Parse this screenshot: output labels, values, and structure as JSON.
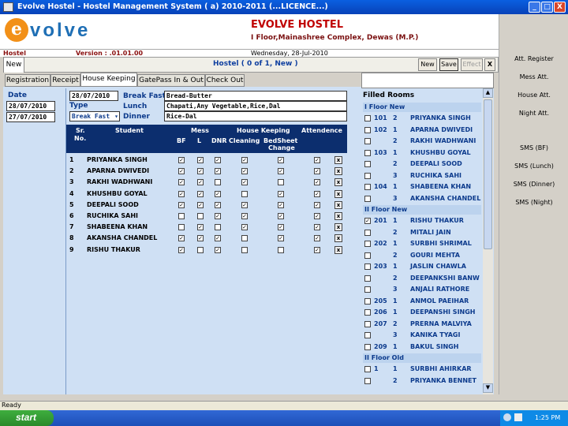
{
  "window": {
    "title": "Evolve Hostel - Hostel Management System ( a) 2010-2011 (...LICENCE...)",
    "minimize": "_",
    "maximize": "□",
    "close": "X"
  },
  "header": {
    "logo_text": "volve",
    "logo_letter": "e",
    "hostel_name": "EVOLVE HOSTEL",
    "address": "I Floor,Mainashree Complex, Dewas (M.P.)"
  },
  "infobar": {
    "module": "Hostel",
    "version": "Version : .01.01.00",
    "date": "Wednesday, 28-Jul-2010"
  },
  "ribbon": {
    "new_tab": "New",
    "form_title": "Hostel  ( 0 of 1, New )",
    "new_btn": "New",
    "save_btn": "Save",
    "effect_btn": "Effect",
    "close_btn": "X"
  },
  "tabs": [
    "Registration",
    "Receipt",
    "House Keeping",
    "GatePass In & Out",
    "Check Out"
  ],
  "datepanel": {
    "label": "Date",
    "dates": [
      "28/07/2010",
      "27/07/2010"
    ]
  },
  "menu": {
    "date": "28/07/2010",
    "type_label": "Type",
    "type_value": "Break Fast",
    "breakfast_label": "Break Fast",
    "breakfast": "Bread-Butter",
    "lunch_label": "Lunch",
    "lunch": "Chapati,Any Vegetable,Rice,Dal",
    "dinner_label": "Dinner",
    "dinner": "Rice-Dal"
  },
  "grid": {
    "headers": {
      "sr": "Sr.",
      "no": "No.",
      "student": "Student",
      "mess": "Mess",
      "bf": "BF",
      "l": "L",
      "dnr": "DNR",
      "hk": "House Keeping",
      "cleaning": "Cleaning",
      "bedsheet": "BedSheet",
      "change": "Change",
      "attendance": "Attendence"
    },
    "rows": [
      {
        "no": "1",
        "name": "PRIYANKA SINGH",
        "bf": true,
        "l": true,
        "dnr": true,
        "cleaning": true,
        "bedsheet": true,
        "att": true
      },
      {
        "no": "2",
        "name": "APARNA DWIVEDI",
        "bf": true,
        "l": true,
        "dnr": true,
        "cleaning": true,
        "bedsheet": true,
        "att": true
      },
      {
        "no": "3",
        "name": "RAKHI WADHWANI",
        "bf": true,
        "l": true,
        "dnr": false,
        "cleaning": true,
        "bedsheet": false,
        "att": true
      },
      {
        "no": "4",
        "name": "KHUSHBU GOYAL",
        "bf": true,
        "l": true,
        "dnr": true,
        "cleaning": false,
        "bedsheet": true,
        "att": true
      },
      {
        "no": "5",
        "name": "DEEPALI SOOD",
        "bf": true,
        "l": true,
        "dnr": true,
        "cleaning": true,
        "bedsheet": true,
        "att": true
      },
      {
        "no": "6",
        "name": "RUCHIKA SAHI",
        "bf": false,
        "l": false,
        "dnr": true,
        "cleaning": true,
        "bedsheet": true,
        "att": true
      },
      {
        "no": "7",
        "name": "SHABEENA KHAN",
        "bf": false,
        "l": true,
        "dnr": false,
        "cleaning": true,
        "bedsheet": true,
        "att": true
      },
      {
        "no": "8",
        "name": "AKANSHA CHANDEL",
        "bf": true,
        "l": true,
        "dnr": true,
        "cleaning": false,
        "bedsheet": true,
        "att": true
      },
      {
        "no": "9",
        "name": "RISHU THAKUR",
        "bf": true,
        "l": false,
        "dnr": true,
        "cleaning": false,
        "bedsheet": false,
        "att": true
      }
    ],
    "x_label": "x"
  },
  "filled_rooms": {
    "title": "Filled Rooms",
    "groups": [
      {
        "name": "I Floor New",
        "rows": [
          {
            "room": "101",
            "bed": "2",
            "name": "PRIYANKA SINGH",
            "checked": false
          },
          {
            "room": "102",
            "bed": "1",
            "name": "APARNA DWIVEDI",
            "checked": false
          },
          {
            "room": "",
            "bed": "2",
            "name": "RAKHI WADHWANI",
            "checked": false
          },
          {
            "room": "103",
            "bed": "1",
            "name": "KHUSHBU GOYAL",
            "checked": false
          },
          {
            "room": "",
            "bed": "2",
            "name": "DEEPALI SOOD",
            "checked": false
          },
          {
            "room": "",
            "bed": "3",
            "name": "RUCHIKA SAHI",
            "checked": false
          },
          {
            "room": "104",
            "bed": "1",
            "name": "SHABEENA KHAN",
            "checked": false
          },
          {
            "room": "",
            "bed": "3",
            "name": "AKANSHA CHANDEL",
            "checked": false
          }
        ]
      },
      {
        "name": "II Floor New",
        "rows": [
          {
            "room": "201",
            "bed": "1",
            "name": "RISHU THAKUR",
            "checked": true
          },
          {
            "room": "",
            "bed": "2",
            "name": "MITALI JAIN",
            "checked": false
          },
          {
            "room": "202",
            "bed": "1",
            "name": "SURBHI SHRIMAL",
            "checked": false
          },
          {
            "room": "",
            "bed": "2",
            "name": "GOURI MEHTA",
            "checked": false
          },
          {
            "room": "203",
            "bed": "1",
            "name": "JASLIN CHAWLA",
            "checked": false
          },
          {
            "room": "",
            "bed": "2",
            "name": "DEEPANKSHI BANW",
            "checked": false
          },
          {
            "room": "",
            "bed": "3",
            "name": "ANJALI RATHORE",
            "checked": false
          },
          {
            "room": "205",
            "bed": "1",
            "name": "ANMOL PAEIHAR",
            "checked": false
          },
          {
            "room": "206",
            "bed": "1",
            "name": "DEEPANSHI SINGH",
            "checked": false
          },
          {
            "room": "207",
            "bed": "2",
            "name": "PRERNA MALVIYA",
            "checked": false
          },
          {
            "room": "",
            "bed": "3",
            "name": "KANIKA TYAGI",
            "checked": false
          },
          {
            "room": "209",
            "bed": "1",
            "name": "BAKUL SINGH",
            "checked": false
          }
        ]
      },
      {
        "name": "II Floor Old",
        "rows": [
          {
            "room": "1",
            "bed": "1",
            "name": "SURBHI AHIRKAR",
            "checked": false
          },
          {
            "room": "",
            "bed": "2",
            "name": "PRIYANKA BENNET",
            "checked": false
          }
        ]
      }
    ]
  },
  "sidebar": [
    "Att. Register",
    "Mess Att.",
    "House Att.",
    "Night Att.",
    "SMS (BF)",
    "SMS (Lunch)",
    "SMS (Dinner)",
    "SMS (Night)"
  ],
  "status": "Ready",
  "taskbar": {
    "start": "start",
    "time": "1:25 PM"
  },
  "colors": {
    "accent": "#0c2e6e",
    "brand": "#c00000",
    "panel": "#cfe0f4"
  }
}
